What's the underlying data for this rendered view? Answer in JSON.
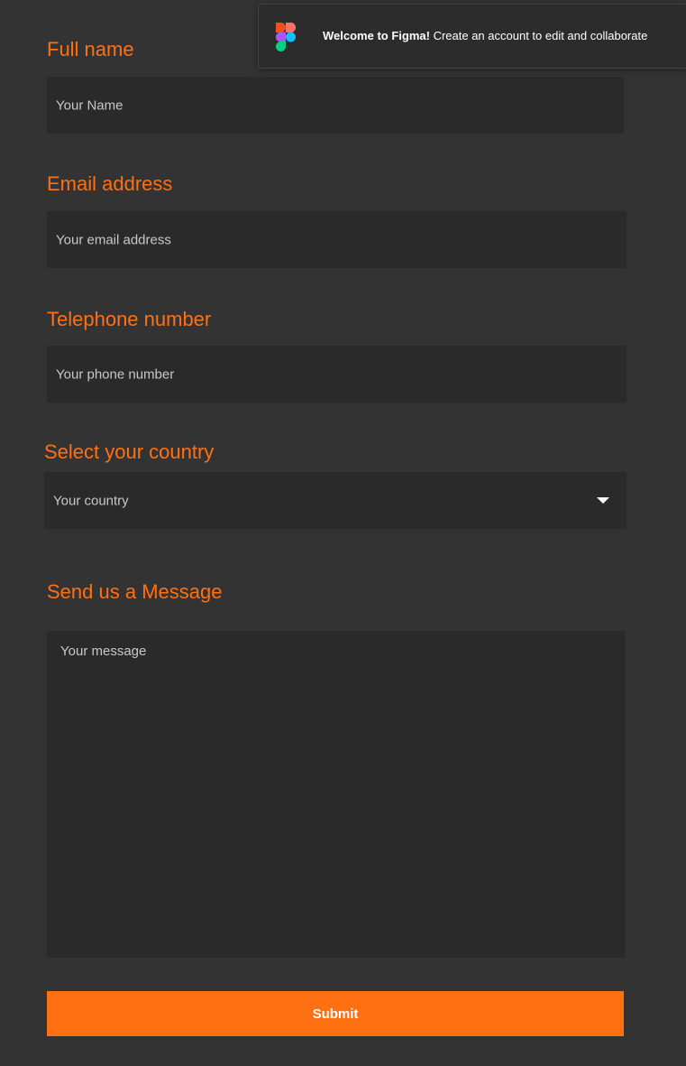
{
  "banner": {
    "welcome_bold": "Welcome to Figma!",
    "welcome_rest": " Create an account to edit and collaborate",
    "icon": "figma-logo-icon"
  },
  "form": {
    "full_name": {
      "label": "Full name",
      "placeholder": "Your Name"
    },
    "email": {
      "label": "Email address",
      "placeholder": "Your email address"
    },
    "phone": {
      "label": "Telephone number",
      "placeholder": "Your phone number"
    },
    "country": {
      "label": "Select your country",
      "selected": "Your country",
      "icon": "caret-down-icon"
    },
    "message": {
      "label": "Send us a Message",
      "placeholder": "Your message"
    },
    "submit_label": "Submit"
  },
  "colors": {
    "accent": "#FF7013",
    "background": "#333333",
    "field_background": "#2A2A2A",
    "placeholder_text": "#C8C8C8"
  }
}
